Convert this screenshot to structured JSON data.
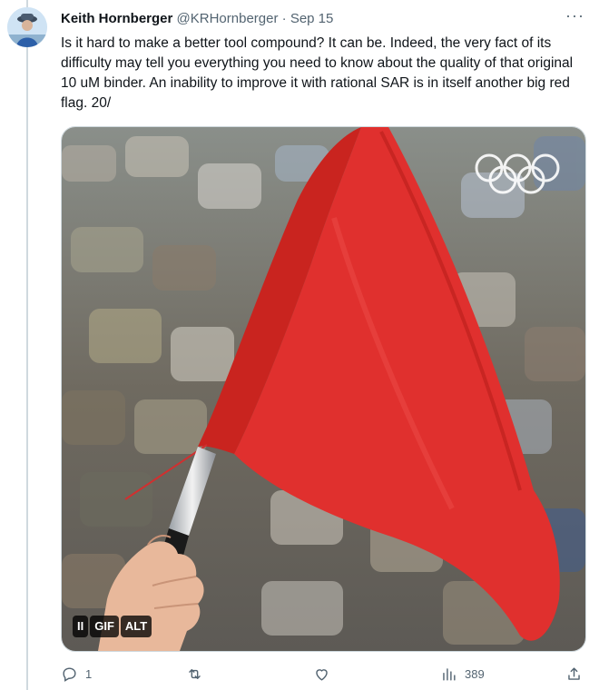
{
  "tweet": {
    "author_name": "Keith Hornberger",
    "handle": "@KRHornberger",
    "separator": "·",
    "date": "Sep 15",
    "more_label": "···",
    "text": "Is it hard to make a better tool compound? It can be. Indeed, the very fact of its difficulty may tell you everything you need to know about the quality of that original 10 uM binder. An inability to improve it with rational SAR is in itself another big red flag. 20/"
  },
  "media": {
    "type": "gif",
    "subject": "red-flag-waved-in-stadium",
    "watermark": "olympic-rings",
    "flag_color": "#e0302e",
    "badges": {
      "pause_label": "II",
      "gif_label": "GIF",
      "alt_label": "ALT"
    }
  },
  "actions": {
    "reply_icon": "reply-icon",
    "reply_count": "1",
    "retweet_icon": "retweet-icon",
    "like_icon": "like-icon",
    "views_icon": "views-icon",
    "views_count": "389",
    "share_icon": "share-icon"
  },
  "colors": {
    "text_primary": "#0f1419",
    "text_secondary": "#536471",
    "border": "#cfd9de"
  }
}
